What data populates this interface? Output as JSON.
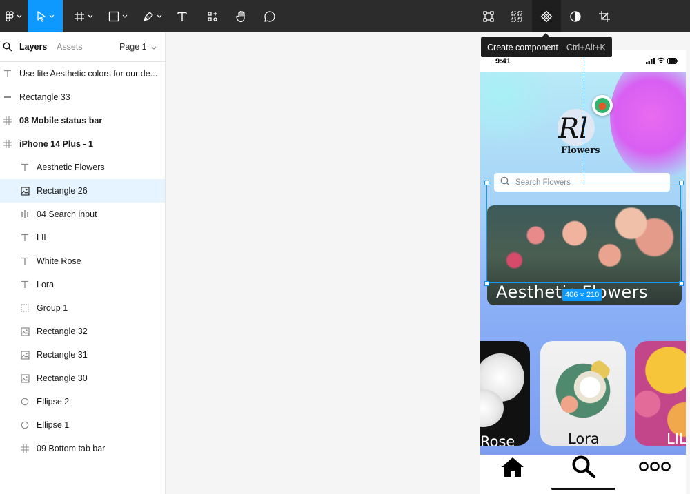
{
  "toolbar": {
    "tools": [
      "main-menu",
      "move",
      "frame",
      "shape",
      "pen",
      "text",
      "resources",
      "hand",
      "comment"
    ],
    "actions": [
      "bounding-box",
      "grid",
      "component",
      "mask",
      "crop"
    ]
  },
  "tooltip": {
    "label": "Create component",
    "shortcut": "Ctrl+Alt+K"
  },
  "panel": {
    "tab_layers": "Layers",
    "tab_assets": "Assets",
    "page": "Page 1",
    "layers": [
      {
        "label": "Use lite Aesthetic colors for our de...",
        "icon": "text"
      },
      {
        "label": "Rectangle 33",
        "icon": "line"
      },
      {
        "label": "08 Mobile status bar",
        "icon": "frame"
      },
      {
        "label": "iPhone 14 Plus - 1",
        "icon": "frame"
      },
      {
        "label": "Aesthetic Flowers",
        "icon": "text"
      },
      {
        "label": "Rectangle 26",
        "icon": "image"
      },
      {
        "label": "04 Search input",
        "icon": "instance"
      },
      {
        "label": "LIL",
        "icon": "text"
      },
      {
        "label": "White Rose",
        "icon": "text"
      },
      {
        "label": "Lora",
        "icon": "text"
      },
      {
        "label": "Group 1",
        "icon": "group"
      },
      {
        "label": "Rectangle 32",
        "icon": "image"
      },
      {
        "label": "Rectangle 31",
        "icon": "image"
      },
      {
        "label": "Rectangle 30",
        "icon": "image"
      },
      {
        "label": "Ellipse 2",
        "icon": "ellipse"
      },
      {
        "label": "Ellipse 1",
        "icon": "ellipse"
      },
      {
        "label": "09 Bottom tab bar",
        "icon": "frame"
      }
    ]
  },
  "phone": {
    "time": "9:41",
    "logo_script": "Rl",
    "logo_sub": "Flowers",
    "search_placeholder": "Search Flowers",
    "hero_title": "Aesthetic Flowers",
    "cards": [
      {
        "label": "Rose"
      },
      {
        "label": "Lora"
      },
      {
        "label": "LIL"
      }
    ]
  },
  "selection": {
    "dimensions": "406 × 210"
  },
  "colors": {
    "accent": "#0d99ff",
    "toolbar_bg": "#2c2c2c",
    "selected_row": "#e5f4ff"
  }
}
